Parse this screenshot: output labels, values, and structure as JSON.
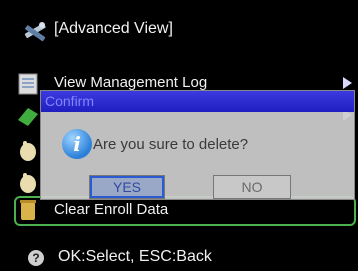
{
  "header": {
    "title": "[Advanced View]",
    "icon": "wrench-screwdriver-icon"
  },
  "menu": {
    "items": [
      {
        "label": "View Management Log",
        "icon": "log-icon",
        "has_submenu": true
      },
      {
        "label": "",
        "icon": "eraser-icon",
        "has_submenu": true
      },
      {
        "label": "",
        "icon": "hand-icon",
        "has_submenu": false
      },
      {
        "label": "",
        "icon": "hand-icon",
        "has_submenu": false
      },
      {
        "label": "Clear Enroll Data",
        "icon": "trash-can-icon",
        "has_submenu": false,
        "selected": true
      }
    ]
  },
  "dialog": {
    "title": "Confirm",
    "message": "Are you sure to delete?",
    "yes_label": "YES",
    "no_label": "NO",
    "icon": "info-icon",
    "icon_glyph": "i"
  },
  "footer": {
    "hint": "OK:Select, ESC:Back",
    "help_glyph": "?"
  },
  "colors": {
    "background": "#000000",
    "selection_border": "#4caf50",
    "dialog_titlebar": "#2a2ad8",
    "focused_button": "#2a5bd0"
  }
}
